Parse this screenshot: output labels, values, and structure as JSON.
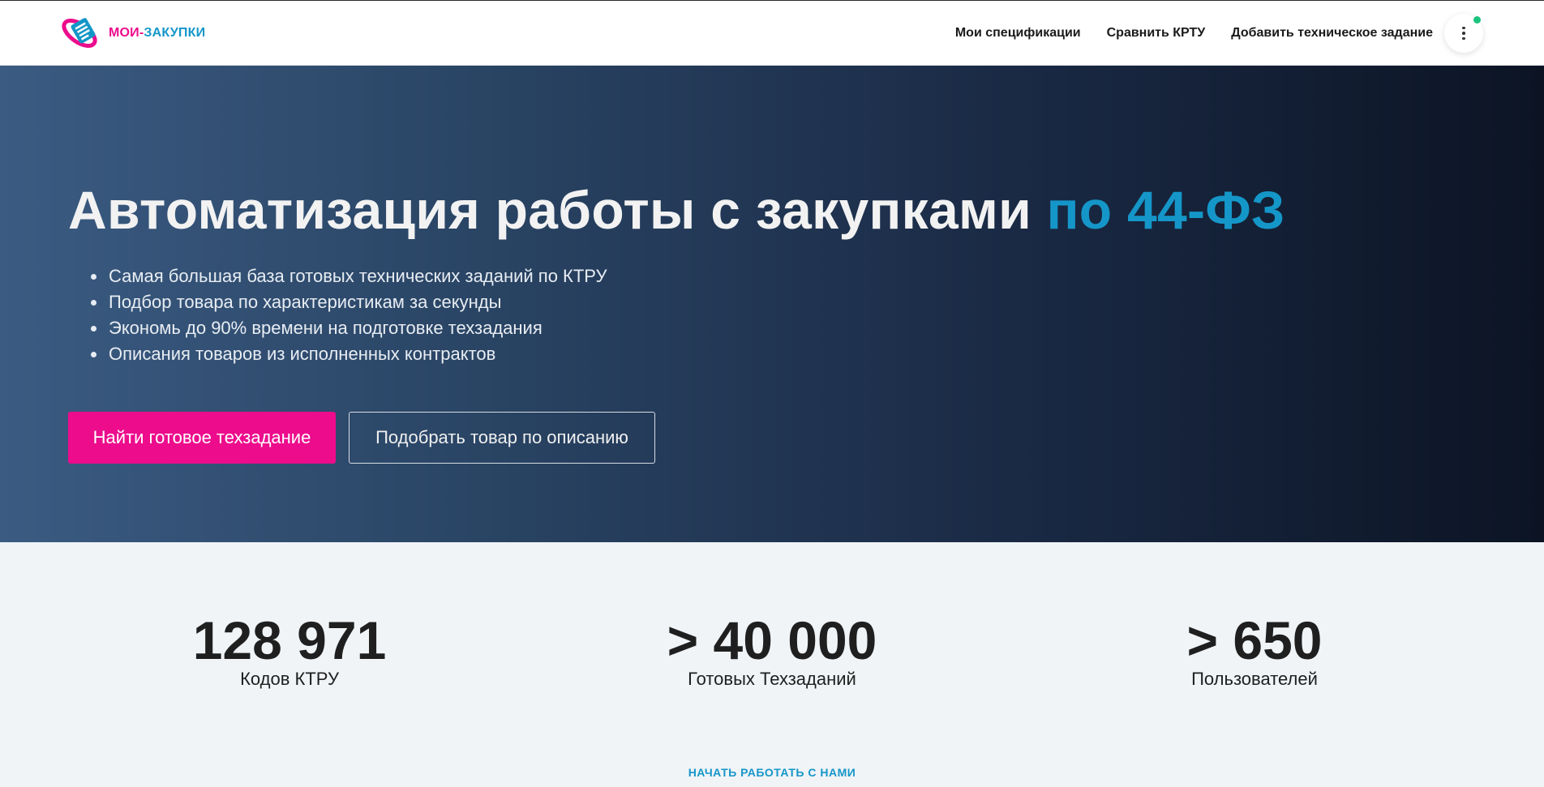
{
  "header": {
    "logo_text_part1": "МОИ-",
    "logo_text_part2": "ЗАКУПКИ",
    "nav": [
      {
        "label": "Мои спецификации"
      },
      {
        "label": "Сравнить КРТУ"
      },
      {
        "label": "Добавить техническое задание"
      }
    ],
    "menu_icon": "more-vertical-icon"
  },
  "hero": {
    "title_main": "Автоматизация работы с закупками",
    "title_accent": "по 44-ФЗ",
    "bullets": [
      "Самая большая база готовых технических заданий по КТРУ",
      "Подбор товара по характеристикам за секунды",
      "Экономь до 90% времени на подготовке техзадания",
      "Описания товаров из исполненных контрактов"
    ],
    "primary_button": "Найти готовое техзадание",
    "secondary_button": "Подобрать товар по описанию"
  },
  "stats": [
    {
      "value": "128 971",
      "label": "Кодов КТРУ"
    },
    {
      "value": "> 40 000",
      "label": "Готовых Техзаданий"
    },
    {
      "value": "> 650",
      "label": "Пользователей"
    }
  ],
  "cta_link": "НАЧАТЬ РАБОТАТЬ С НАМИ",
  "colors": {
    "brand_pink": "#ec0c8c",
    "brand_blue": "#1596c8",
    "status_green": "#1bc47d"
  }
}
